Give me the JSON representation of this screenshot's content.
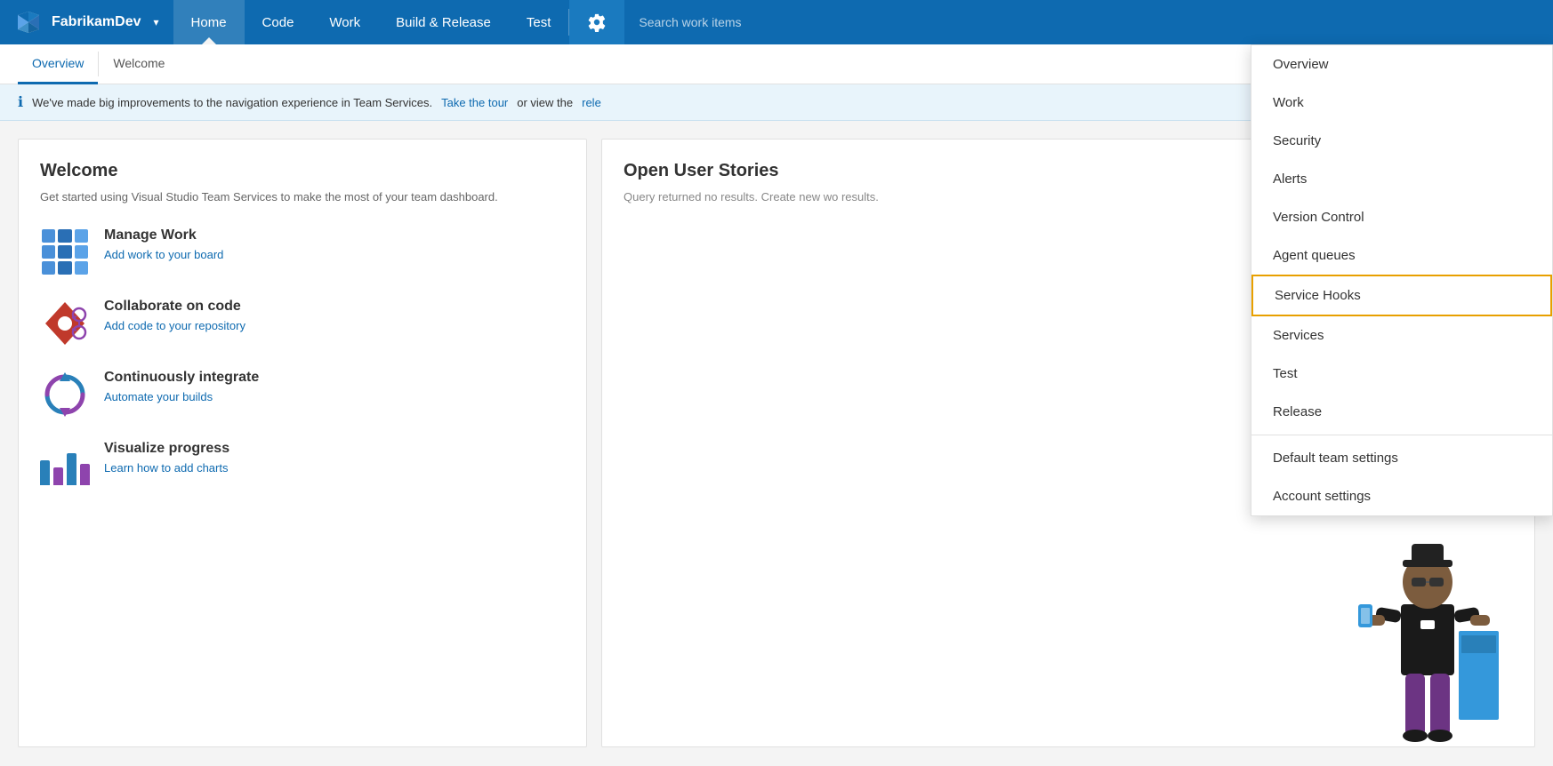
{
  "brand": {
    "name": "FabrikamDev",
    "dropdown_label": "▾"
  },
  "nav": {
    "items": [
      {
        "id": "home",
        "label": "Home",
        "active": true
      },
      {
        "id": "code",
        "label": "Code",
        "active": false
      },
      {
        "id": "work",
        "label": "Work",
        "active": false
      },
      {
        "id": "build-release",
        "label": "Build & Release",
        "active": false
      },
      {
        "id": "test",
        "label": "Test",
        "active": false
      }
    ],
    "search_placeholder": "Search work items"
  },
  "sub_nav": {
    "items": [
      {
        "id": "overview",
        "label": "Overview",
        "active": true
      },
      {
        "id": "welcome",
        "label": "Welcome",
        "active": false
      }
    ]
  },
  "info_banner": {
    "text": "We've made big improvements to the navigation experience in Team Services.",
    "link1": "Take the tour",
    "text2": "or view the",
    "link2": "rele"
  },
  "welcome_card": {
    "title": "Welcome",
    "description": "Get started using Visual Studio Team Services to make the most of your team dashboard.",
    "items": [
      {
        "id": "manage-work",
        "title": "Manage Work",
        "link_text": "Add work to your board"
      },
      {
        "id": "collaborate-code",
        "title": "Collaborate on code",
        "link_text": "Add code to your repository"
      },
      {
        "id": "continuously-integrate",
        "title": "Continuously integrate",
        "link_text": "Automate your builds"
      },
      {
        "id": "visualize-progress",
        "title": "Visualize progress",
        "link_text": "Learn how to add charts"
      }
    ]
  },
  "user_stories_card": {
    "title": "Open User Stories",
    "description": "Query returned no results. Create new wo results."
  },
  "dropdown": {
    "items": [
      {
        "id": "overview",
        "label": "Overview",
        "highlighted": false
      },
      {
        "id": "work",
        "label": "Work",
        "highlighted": false
      },
      {
        "id": "security",
        "label": "Security",
        "highlighted": false
      },
      {
        "id": "alerts",
        "label": "Alerts",
        "highlighted": false
      },
      {
        "id": "version-control",
        "label": "Version Control",
        "highlighted": false
      },
      {
        "id": "agent-queues",
        "label": "Agent queues",
        "highlighted": false
      },
      {
        "id": "service-hooks",
        "label": "Service Hooks",
        "highlighted": true
      },
      {
        "id": "services",
        "label": "Services",
        "highlighted": false
      },
      {
        "id": "test",
        "label": "Test",
        "highlighted": false
      },
      {
        "id": "release",
        "label": "Release",
        "highlighted": false
      },
      {
        "id": "default-team-settings",
        "label": "Default team settings",
        "highlighted": false
      },
      {
        "id": "account-settings",
        "label": "Account settings",
        "highlighted": false
      }
    ],
    "divider_after": [
      9
    ]
  },
  "colors": {
    "nav_blue": "#0e6ab0",
    "gear_bg": "#1a7abf",
    "accent_orange": "#e8a000",
    "link_blue": "#0e6ab0",
    "kanban_blue1": "#4a90d9",
    "kanban_blue2": "#2a6fb5",
    "kanban_blue3": "#5ba3e8",
    "code_red": "#c0392b",
    "integrate_blue": "#2980b9",
    "integrate_purple": "#8e44ad",
    "chart_blue": "#2980b9",
    "chart_purple": "#8e44ad",
    "chart_teal": "#1abc9c"
  }
}
